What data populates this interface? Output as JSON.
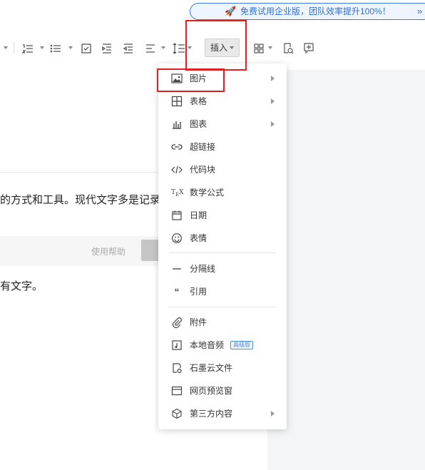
{
  "promo": {
    "text": "免费试用企业版，团队效率提升100%！"
  },
  "toolbar": {
    "insert_label": "插入",
    "icons": [
      "unordered-list",
      "ordered-list",
      "bullet-list",
      "checkbox",
      "indent-increase",
      "indent-decrease",
      "align",
      "line-height",
      "grid",
      "search-doc",
      "add-comment"
    ]
  },
  "document": {
    "line1": "的方式和工具。现代文字多是记录",
    "help_button": "使用帮助",
    "line2": "有文字。"
  },
  "insert_menu": {
    "items": [
      {
        "label": "图片",
        "icon": "image-icon",
        "submenu": true
      },
      {
        "label": "表格",
        "icon": "table-icon",
        "submenu": true
      },
      {
        "label": "图表",
        "icon": "chart-icon",
        "submenu": true
      },
      {
        "label": "超链接",
        "icon": "link-icon",
        "submenu": false
      },
      {
        "label": "代码块",
        "icon": "code-icon",
        "submenu": false
      },
      {
        "label": "数学公式",
        "icon": "tex-icon",
        "submenu": false
      },
      {
        "label": "日期",
        "icon": "calendar-icon",
        "submenu": false
      },
      {
        "label": "表情",
        "icon": "emoji-icon",
        "submenu": false
      },
      {
        "label": "分隔线",
        "icon": "divider-icon",
        "submenu": false
      },
      {
        "label": "引用",
        "icon": "quote-icon",
        "submenu": false
      },
      {
        "label": "附件",
        "icon": "attachment-icon",
        "submenu": false
      },
      {
        "label": "本地音频",
        "icon": "audio-icon",
        "submenu": false,
        "badge": "高级版"
      },
      {
        "label": "石墨云文件",
        "icon": "cloud-file-icon",
        "submenu": false
      },
      {
        "label": "网页预览窗",
        "icon": "webpage-icon",
        "submenu": false
      },
      {
        "label": "第三方内容",
        "icon": "cube-icon",
        "submenu": true
      }
    ]
  },
  "colors": {
    "highlight": "#e02020",
    "promo_border": "#3d7bd8",
    "badge": "#4a8be0"
  }
}
